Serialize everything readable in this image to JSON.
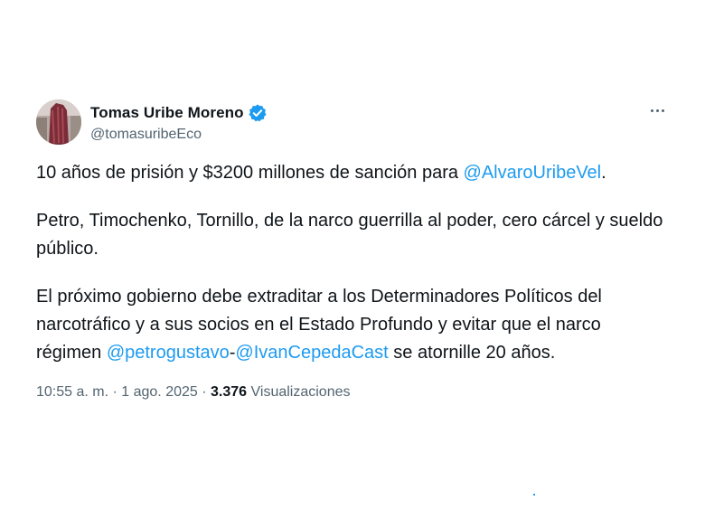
{
  "author": {
    "display_name": "Tomas Uribe Moreno",
    "handle": "@tomasuribeEco",
    "verified_icon": "verified-badge-icon",
    "avatar_icon": "avatar-photo"
  },
  "more_icon": "more-options-icon",
  "body": {
    "p1_text": "10 años de prisión y $3200 millones de sanción para ",
    "p1_mention": "@AlvaroUribeVel",
    "p1_end": ".",
    "p2_text": "Petro, Timochenko, Tornillo, de la narco guerrilla al poder, cero cárcel y sueldo público.",
    "p3_text": "El próximo gobierno debe extraditar a los Determinadores Políticos del narcotráfico y a sus socios en el Estado Profundo y evitar que el narco régimen ",
    "p3_mention1": "@petrogustavo",
    "p3_dash": "-",
    "p3_mention2": "@IvanCepedaCast",
    "p3_end": " se atornille 20 años."
  },
  "meta": {
    "timestamp": "10:55 a. m. · 1 ago. 2025 · ",
    "views_count": "3.376",
    "views_label": " Visualizaciones"
  },
  "colors": {
    "accent": "#1d9bf0",
    "text": "#0f1419",
    "secondary": "#536471"
  }
}
